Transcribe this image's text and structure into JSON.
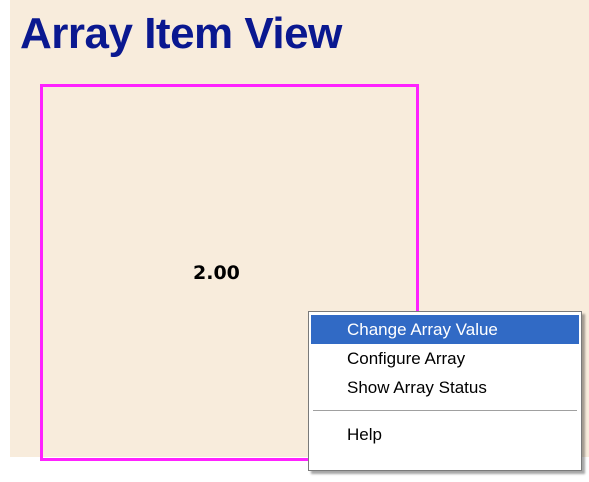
{
  "page": {
    "title": "Array Item View"
  },
  "array_item": {
    "value": "2.00",
    "border_color": "#ff22ff"
  },
  "context_menu": {
    "items": [
      {
        "label": "Change Array Value",
        "selected": true
      },
      {
        "label": "Configure Array",
        "selected": false
      },
      {
        "label": "Show Array Status",
        "selected": false
      },
      {
        "label": "Help",
        "selected": false
      }
    ],
    "highlight_color": "#316ac5"
  },
  "colors": {
    "background": "#f8ecdc",
    "title": "#0a1890"
  }
}
